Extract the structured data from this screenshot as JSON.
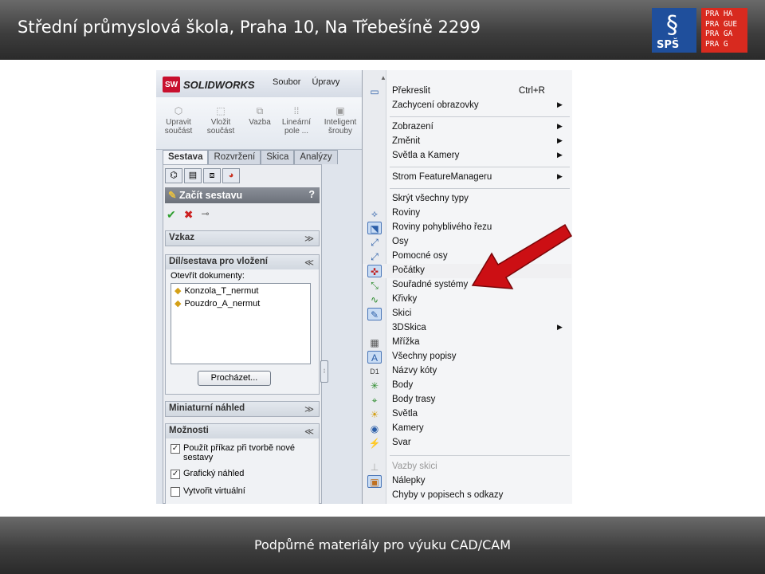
{
  "header": {
    "title": "Střední průmyslová škola, Praha 10, Na Třebešíně 2299",
    "logo_sps_text": "SPŠ",
    "logo_praha_lines": [
      "PRA HA",
      "PRA GUE",
      "PRA GA",
      "PRA G"
    ]
  },
  "footer": {
    "text": "Podpůrné materiály pro výuku CAD/CAM"
  },
  "solidworks": {
    "app_name": "SOLIDWORKS",
    "logo_badge": "SW",
    "menu": [
      "Soubor",
      "Úpravy"
    ],
    "toolbar": [
      {
        "label": "Upravit součást",
        "icon": "edit-part-icon"
      },
      {
        "label": "Vložit součást",
        "icon": "insert-component-icon"
      },
      {
        "label": "Vazba",
        "icon": "mate-icon"
      },
      {
        "label": "Lineární pole ...",
        "icon": "linear-pattern-icon"
      },
      {
        "label": "Inteligent šrouby",
        "icon": "smart-fasteners-icon"
      }
    ],
    "tabs": [
      "Sestava",
      "Rozvržení",
      "Skica",
      "Analýzy"
    ],
    "active_tab": "Sestava",
    "property_manager": {
      "title": "Začít sestavu",
      "help": "?",
      "groups": {
        "message": "Vzkaz",
        "insert": "Díl/sestava pro vložení",
        "open_docs_label": "Otevřít dokumenty:",
        "documents": [
          "Konzola_T_nermut",
          "Pouzdro_A_nermut"
        ],
        "browse_button": "Procházet...",
        "thumbnail": "Miniaturní náhled",
        "options": "Možnosti"
      },
      "options": [
        {
          "label": "Použít příkaz při tvorbě nové sestavy",
          "checked": true
        },
        {
          "label": "Grafický náhled",
          "checked": true
        },
        {
          "label": "Vytvořit virtuální",
          "checked": false
        }
      ]
    }
  },
  "context_menu": {
    "items": [
      {
        "label": "Překreslit",
        "shortcut": "Ctrl+R",
        "icon": "redraw-icon"
      },
      {
        "label": "Zachycení obrazovky",
        "submenu": true
      },
      {
        "label": "Zobrazení",
        "submenu": true
      },
      {
        "label": "Změnit",
        "submenu": true
      },
      {
        "label": "Světla a Kamery",
        "submenu": true
      },
      {
        "label": "Strom FeatureManageru",
        "submenu": true
      },
      {
        "label": "Skrýt všechny typy"
      },
      {
        "label": "Roviny",
        "icon": "planes-icon"
      },
      {
        "label": "Roviny pohyblivého řezu",
        "icon": "live-section-planes-icon"
      },
      {
        "label": "Osy",
        "icon": "axes-icon"
      },
      {
        "label": "Pomocné osy",
        "icon": "temporary-axes-icon"
      },
      {
        "label": "Počátky",
        "icon": "origins-icon"
      },
      {
        "label": "Souřadné systémy",
        "icon": "coordinate-systems-icon"
      },
      {
        "label": "Křivky",
        "icon": "curves-icon"
      },
      {
        "label": "Skici",
        "icon": "sketches-icon"
      },
      {
        "label": "3DSkica",
        "submenu": true
      },
      {
        "label": "Mřížka",
        "icon": "grid-icon"
      },
      {
        "label": "Všechny popisy",
        "icon": "all-annotations-icon"
      },
      {
        "label": "Názvy kóty",
        "icon": "dimension-names-icon"
      },
      {
        "label": "Body",
        "icon": "points-icon"
      },
      {
        "label": "Body trasy",
        "icon": "route-points-icon"
      },
      {
        "label": "Světla",
        "icon": "lights-icon"
      },
      {
        "label": "Kamery",
        "icon": "cameras-icon"
      },
      {
        "label": "Svar",
        "icon": "weld-icon"
      },
      {
        "label": "Vazby skici",
        "icon": "sketch-relations-icon",
        "disabled": true
      },
      {
        "label": "Nálepky",
        "icon": "decals-icon"
      },
      {
        "label": "Chyby v popisech s odkazy"
      }
    ]
  },
  "colors": {
    "arrow": "#cc0f14",
    "logo_blue": "#1f4f9c",
    "logo_red": "#d82a1f"
  }
}
